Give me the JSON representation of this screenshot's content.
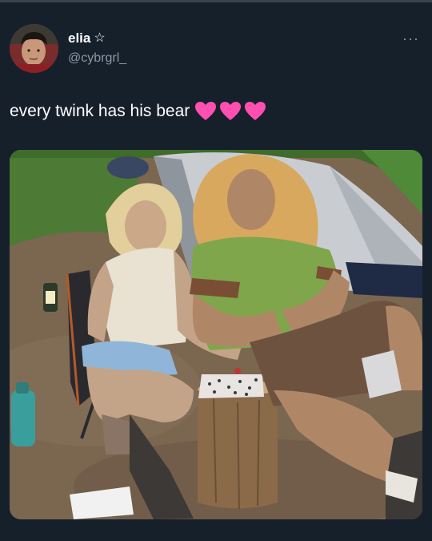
{
  "tweet": {
    "display_name": "elia",
    "name_badge": "☆",
    "handle": "@cybrgrl_",
    "more": "···",
    "text": "every twink has his bear",
    "emoji": [
      "heart",
      "heart",
      "heart"
    ]
  },
  "colors": {
    "background": "#15202b",
    "text": "#ffffff",
    "secondary": "#8b98a5",
    "heart": "#ff4fb0"
  },
  "icons": {
    "more": "more-icon",
    "badge": "star-icon",
    "emoji": "pink-heart-icon"
  },
  "media": {
    "description_type": "illustrated photo edit"
  }
}
